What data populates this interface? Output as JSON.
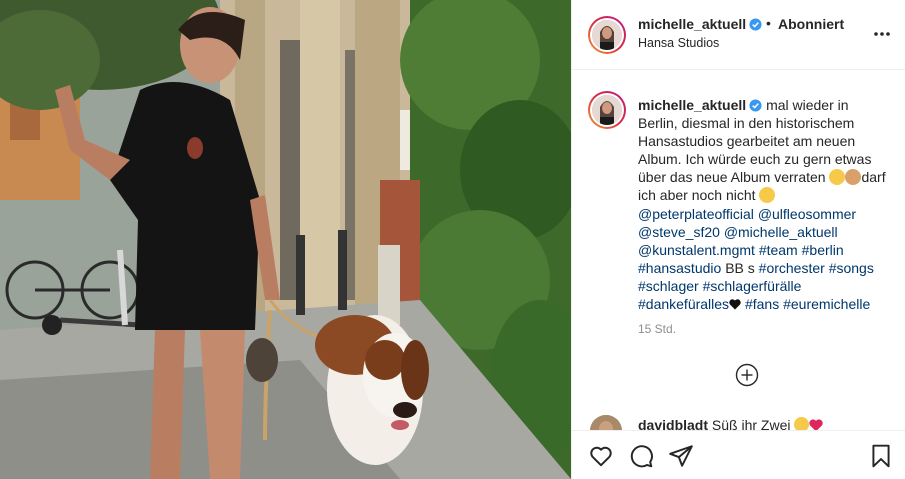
{
  "post": {
    "username": "michelle_aktuell",
    "follow_status": "Abonniert",
    "location": "Hansa Studios",
    "caption_lines": [
      "mal wieder in",
      "Berlin, diesmal in den historischem",
      "Hansastudios gearbeitet am neuen",
      "Album. Ich würde euch zu gern etwas",
      "über das neue Album verraten",
      "darf",
      "ich aber noch nicht"
    ],
    "hashtags": {
      "line1": [
        "@peterplateofficial",
        "@ulfleosommer"
      ],
      "line2": [
        "@steve_sf20",
        "@michelle_aktuell"
      ],
      "line3": [
        "@kunstalent.mgmt",
        "#team",
        "#berlin"
      ],
      "line4": [
        "#hansastudio"
      ],
      "line4_text": "BB s",
      "line4b": [
        "#orchester",
        "#songs"
      ],
      "line5": [
        "#schlager",
        "#schlagerfürälle"
      ],
      "line6a": "#dankefüralles",
      "line6b": [
        "#fans",
        "#euremichelle"
      ]
    },
    "time_ago": "15 Std."
  },
  "comment": {
    "username": "davidbladt",
    "text": "Süß ihr Zwei"
  },
  "icons": {
    "verified": "verified-badge-icon",
    "more": "more-options-icon",
    "load_more": "plus-circle-icon",
    "like": "heart-icon",
    "comment": "comment-bubble-icon",
    "share": "paper-plane-icon",
    "save": "bookmark-icon"
  },
  "colors": {
    "link": "#00376b",
    "verified": "#3897f0",
    "muted": "#8e8e8e",
    "border": "#efefef"
  }
}
